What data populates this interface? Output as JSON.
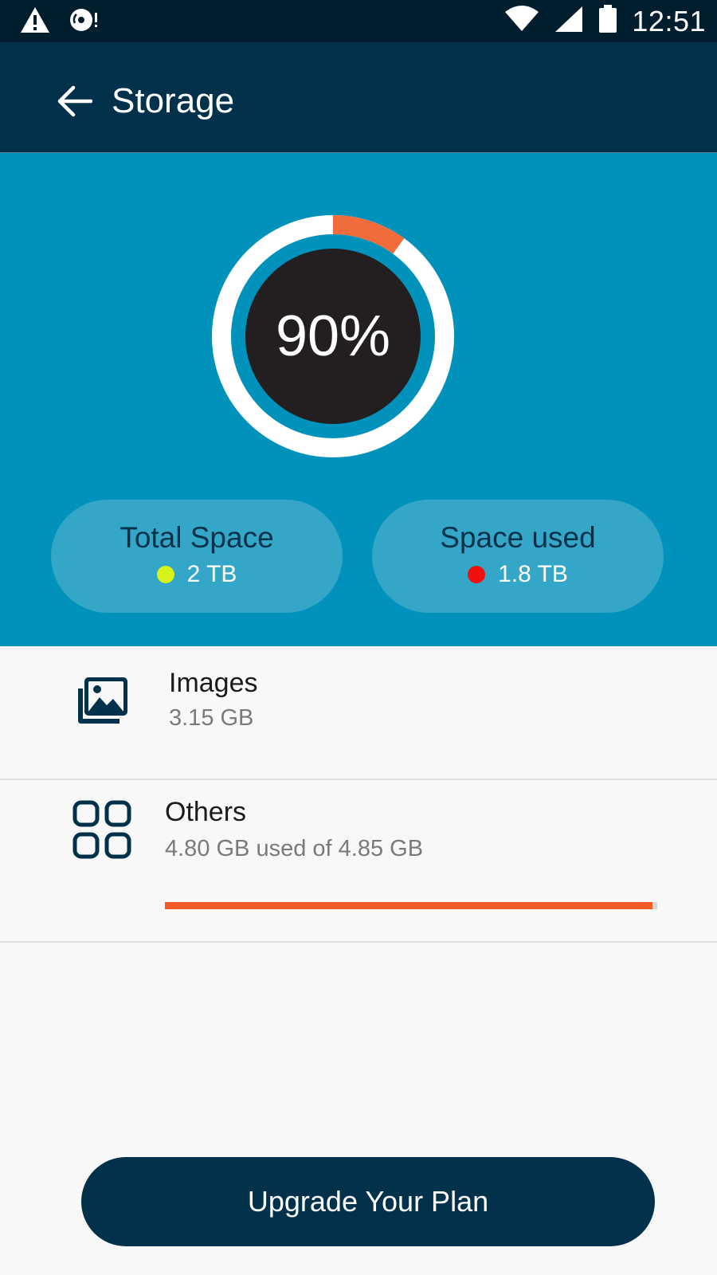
{
  "status_bar": {
    "time": "12:51",
    "icons": [
      "warning-icon",
      "disc-alert-icon",
      "wifi-icon",
      "signal-icon",
      "battery-icon"
    ]
  },
  "header": {
    "title": "Storage",
    "back_icon": "arrow-left-icon"
  },
  "usage_gauge": {
    "percent_label": "90%",
    "used_fraction": 0.1,
    "colors": {
      "ring": "#ffffff",
      "used_arc": "#f26b3a",
      "center": "#231f20",
      "background": "#0192bb"
    }
  },
  "summary": {
    "total": {
      "label": "Total Space",
      "value": "2 TB",
      "dot_color": "#d8f21c"
    },
    "used": {
      "label": "Space used",
      "value": "1.8 TB",
      "dot_color": "#f20f0f"
    }
  },
  "categories": [
    {
      "title": "Images",
      "subtitle": "3.15 GB",
      "icon": "images-icon"
    },
    {
      "title": "Others",
      "subtitle": "4.80 GB used of 4.85 GB",
      "icon": "grid-icon",
      "progress": 0.99
    }
  ],
  "actions": {
    "upgrade_label": "Upgrade Your Plan"
  }
}
